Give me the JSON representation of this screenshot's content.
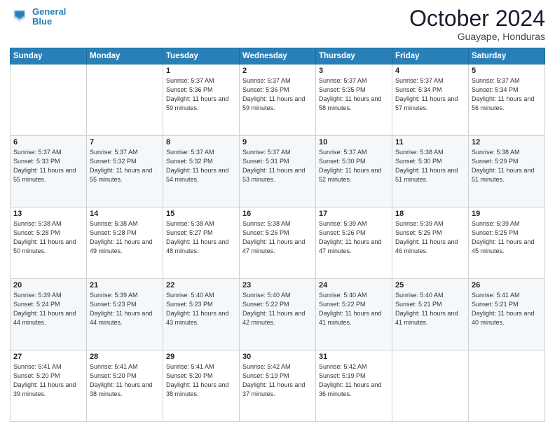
{
  "header": {
    "logo_line1": "General",
    "logo_line2": "Blue",
    "month": "October 2024",
    "location": "Guayape, Honduras"
  },
  "weekdays": [
    "Sunday",
    "Monday",
    "Tuesday",
    "Wednesday",
    "Thursday",
    "Friday",
    "Saturday"
  ],
  "weeks": [
    [
      {
        "day": "",
        "info": ""
      },
      {
        "day": "",
        "info": ""
      },
      {
        "day": "1",
        "info": "Sunrise: 5:37 AM\nSunset: 5:36 PM\nDaylight: 11 hours and 59 minutes."
      },
      {
        "day": "2",
        "info": "Sunrise: 5:37 AM\nSunset: 5:36 PM\nDaylight: 11 hours and 59 minutes."
      },
      {
        "day": "3",
        "info": "Sunrise: 5:37 AM\nSunset: 5:35 PM\nDaylight: 11 hours and 58 minutes."
      },
      {
        "day": "4",
        "info": "Sunrise: 5:37 AM\nSunset: 5:34 PM\nDaylight: 11 hours and 57 minutes."
      },
      {
        "day": "5",
        "info": "Sunrise: 5:37 AM\nSunset: 5:34 PM\nDaylight: 11 hours and 56 minutes."
      }
    ],
    [
      {
        "day": "6",
        "info": "Sunrise: 5:37 AM\nSunset: 5:33 PM\nDaylight: 11 hours and 55 minutes."
      },
      {
        "day": "7",
        "info": "Sunrise: 5:37 AM\nSunset: 5:32 PM\nDaylight: 11 hours and 55 minutes."
      },
      {
        "day": "8",
        "info": "Sunrise: 5:37 AM\nSunset: 5:32 PM\nDaylight: 11 hours and 54 minutes."
      },
      {
        "day": "9",
        "info": "Sunrise: 5:37 AM\nSunset: 5:31 PM\nDaylight: 11 hours and 53 minutes."
      },
      {
        "day": "10",
        "info": "Sunrise: 5:37 AM\nSunset: 5:30 PM\nDaylight: 11 hours and 52 minutes."
      },
      {
        "day": "11",
        "info": "Sunrise: 5:38 AM\nSunset: 5:30 PM\nDaylight: 11 hours and 51 minutes."
      },
      {
        "day": "12",
        "info": "Sunrise: 5:38 AM\nSunset: 5:29 PM\nDaylight: 11 hours and 51 minutes."
      }
    ],
    [
      {
        "day": "13",
        "info": "Sunrise: 5:38 AM\nSunset: 5:28 PM\nDaylight: 11 hours and 50 minutes."
      },
      {
        "day": "14",
        "info": "Sunrise: 5:38 AM\nSunset: 5:28 PM\nDaylight: 11 hours and 49 minutes."
      },
      {
        "day": "15",
        "info": "Sunrise: 5:38 AM\nSunset: 5:27 PM\nDaylight: 11 hours and 48 minutes."
      },
      {
        "day": "16",
        "info": "Sunrise: 5:38 AM\nSunset: 5:26 PM\nDaylight: 11 hours and 47 minutes."
      },
      {
        "day": "17",
        "info": "Sunrise: 5:39 AM\nSunset: 5:26 PM\nDaylight: 11 hours and 47 minutes."
      },
      {
        "day": "18",
        "info": "Sunrise: 5:39 AM\nSunset: 5:25 PM\nDaylight: 11 hours and 46 minutes."
      },
      {
        "day": "19",
        "info": "Sunrise: 5:39 AM\nSunset: 5:25 PM\nDaylight: 11 hours and 45 minutes."
      }
    ],
    [
      {
        "day": "20",
        "info": "Sunrise: 5:39 AM\nSunset: 5:24 PM\nDaylight: 11 hours and 44 minutes."
      },
      {
        "day": "21",
        "info": "Sunrise: 5:39 AM\nSunset: 5:23 PM\nDaylight: 11 hours and 44 minutes."
      },
      {
        "day": "22",
        "info": "Sunrise: 5:40 AM\nSunset: 5:23 PM\nDaylight: 11 hours and 43 minutes."
      },
      {
        "day": "23",
        "info": "Sunrise: 5:40 AM\nSunset: 5:22 PM\nDaylight: 11 hours and 42 minutes."
      },
      {
        "day": "24",
        "info": "Sunrise: 5:40 AM\nSunset: 5:22 PM\nDaylight: 11 hours and 41 minutes."
      },
      {
        "day": "25",
        "info": "Sunrise: 5:40 AM\nSunset: 5:21 PM\nDaylight: 11 hours and 41 minutes."
      },
      {
        "day": "26",
        "info": "Sunrise: 5:41 AM\nSunset: 5:21 PM\nDaylight: 11 hours and 40 minutes."
      }
    ],
    [
      {
        "day": "27",
        "info": "Sunrise: 5:41 AM\nSunset: 5:20 PM\nDaylight: 11 hours and 39 minutes."
      },
      {
        "day": "28",
        "info": "Sunrise: 5:41 AM\nSunset: 5:20 PM\nDaylight: 11 hours and 38 minutes."
      },
      {
        "day": "29",
        "info": "Sunrise: 5:41 AM\nSunset: 5:20 PM\nDaylight: 11 hours and 38 minutes."
      },
      {
        "day": "30",
        "info": "Sunrise: 5:42 AM\nSunset: 5:19 PM\nDaylight: 11 hours and 37 minutes."
      },
      {
        "day": "31",
        "info": "Sunrise: 5:42 AM\nSunset: 5:19 PM\nDaylight: 11 hours and 36 minutes."
      },
      {
        "day": "",
        "info": ""
      },
      {
        "day": "",
        "info": ""
      }
    ]
  ]
}
